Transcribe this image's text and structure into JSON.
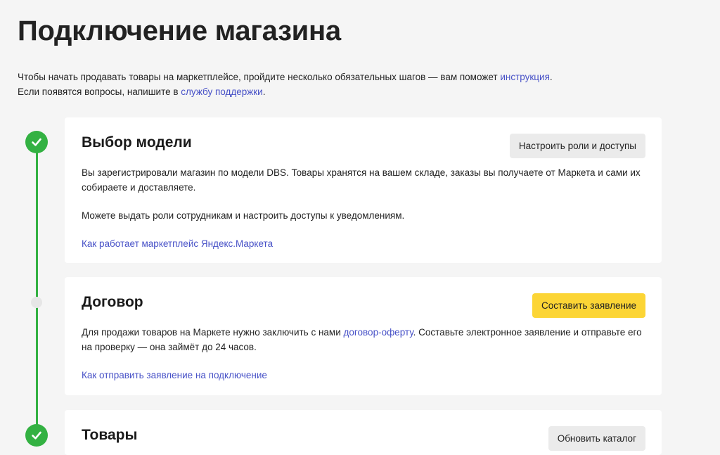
{
  "page": {
    "title": "Подключение магазина",
    "intro_line1_before": "Чтобы начать продавать товары на маркетплейсе, пройдите несколько обязательных шагов — вам поможет ",
    "intro_line1_link": "инструкция",
    "intro_line1_after": ".",
    "intro_line2_before": "Если появятся вопросы, напишите в ",
    "intro_line2_link": "службу поддержки",
    "intro_line2_after": "."
  },
  "steps": [
    {
      "status": "done",
      "title": "Выбор модели",
      "button_label": "Настроить роли и доступы",
      "text1": "Вы зарегистрировали магазин по модели DBS. Товары хранятся на вашем складе, заказы вы получаете от Маркета и сами их собираете и доставляете.",
      "text2": "Можете выдать роли сотрудникам и настроить доступы к уведомлениям.",
      "help_link": "Как работает маркетплейс Яндекс.Маркета"
    },
    {
      "status": "pending",
      "title": "Договор",
      "button_label": "Составить заявление",
      "text_before": "Для продажи товаров на Маркете нужно заключить с нами ",
      "text_link": "договор-оферту",
      "text_after": ". Составьте электронное заявление и отправьте его на проверку — она займёт до 24 часов.",
      "help_link": "Как отправить заявление на подключение"
    },
    {
      "status": "done",
      "title": "Товары",
      "button_label": "Обновить каталог"
    }
  ],
  "colors": {
    "accent_green": "#33b142",
    "link_blue": "#4751c7",
    "primary_yellow": "#fcd535"
  }
}
